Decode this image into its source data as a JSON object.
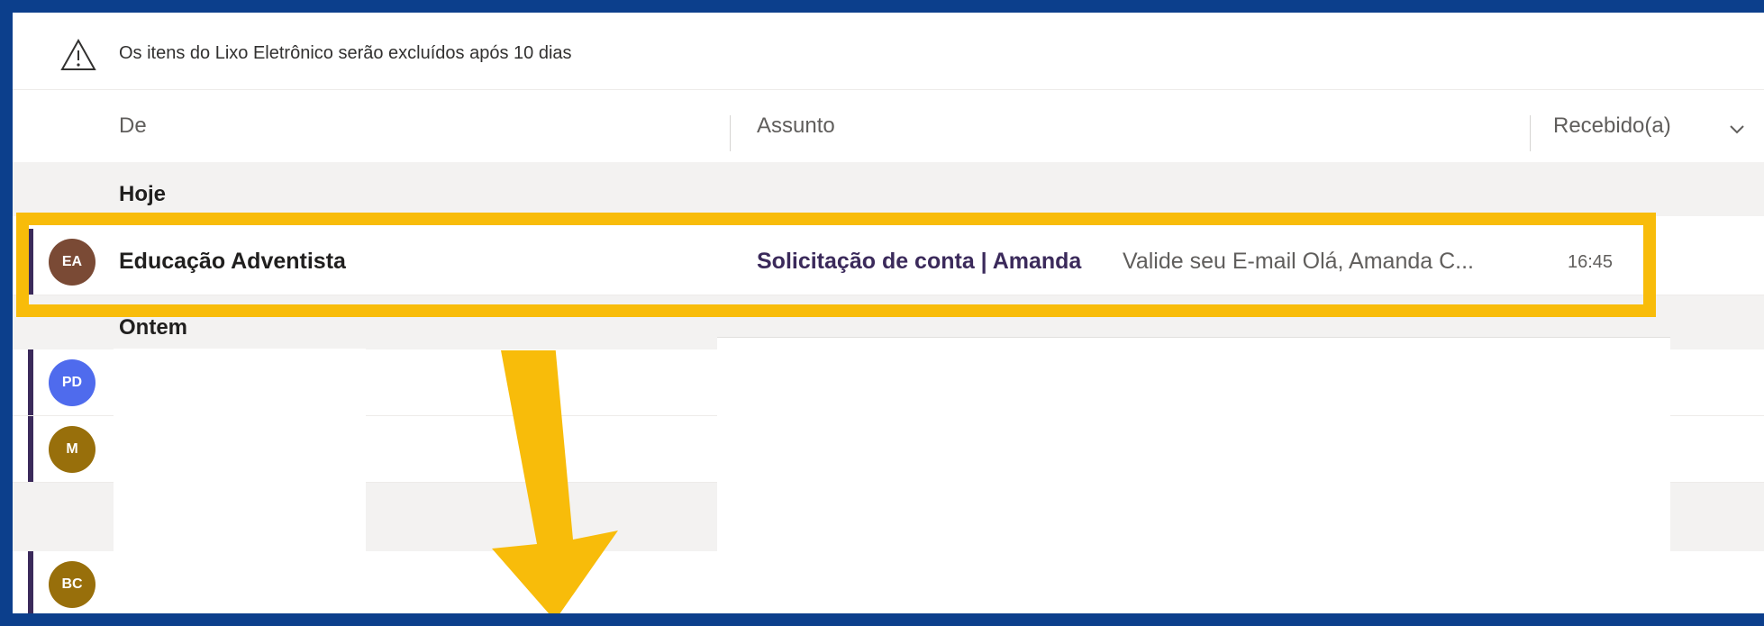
{
  "banner": {
    "text": "Os itens do Lixo Eletrônico serão excluídos após 10 dias",
    "icon": "warning-icon"
  },
  "columns": {
    "from": "De",
    "subject": "Assunto",
    "received": "Recebido(a)"
  },
  "groups": {
    "today": "Hoje",
    "yesterday": "Ontem"
  },
  "message": {
    "initials": "EA",
    "avatar_color": "#7a4a35",
    "sender": "Educação Adventista",
    "subject": "Solicitação de conta | Amanda",
    "preview": "Valide seu E-mail Olá, Amanda C...",
    "time": "16:45"
  },
  "other_rows": [
    {
      "initials": "PD",
      "avatar_color": "#4f6bed"
    },
    {
      "initials": "M",
      "avatar_color": "#986f0b"
    },
    {
      "initials": "BC",
      "avatar_color": "#986f0b"
    }
  ],
  "colors": {
    "highlight": "#f8bc0a",
    "unread_bar": "#3b2a5b",
    "frame_bg": "#0c3f8c"
  }
}
